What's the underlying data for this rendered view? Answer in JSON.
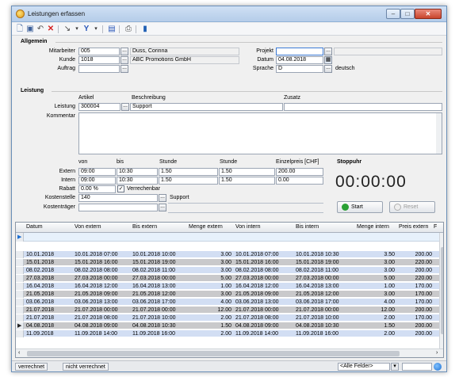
{
  "window": {
    "title": "Leistungen erfassen"
  },
  "toolbar": {
    "icons": [
      "new-doc-icon",
      "save-icon",
      "undo-icon",
      "delete-icon",
      "pointer-icon",
      "filter-icon",
      "report-icon",
      "print-icon",
      "info-icon"
    ]
  },
  "allgemein": {
    "heading": "Allgemein",
    "mitarbeiter_label": "Mitarbeiter",
    "mitarbeiter_value": "005",
    "mitarbeiter_name": "Duss, Corinna",
    "kunde_label": "Kunde",
    "kunde_value": "1018",
    "kunde_name": "ABC Promotions GmbH",
    "auftrag_label": "Auftrag",
    "auftrag_value": "",
    "projekt_label": "Projekt",
    "projekt_value": "",
    "datum_label": "Datum",
    "datum_value": "04.08.2018",
    "sprache_label": "Sprache",
    "sprache_value": "D",
    "sprache_name": "deutsch"
  },
  "leistung": {
    "heading": "Leistung",
    "col_artikel": "Artikel",
    "col_beschreibung": "Beschreibung",
    "col_zusatz": "Zusatz",
    "leistung_label": "Leistung",
    "artikel_value": "300004",
    "beschreibung_value": "Support",
    "kommentar_label": "Kommentar",
    "col_von": "von",
    "col_bis": "bis",
    "col_stunde1": "Stunde",
    "col_stunde2": "Stunde",
    "col_einzelpreis": "Einzelpreis [CHF]",
    "extern_label": "Extern",
    "extern_von": "09:00",
    "extern_bis": "10:30",
    "extern_stunde1": "1.50",
    "extern_stunde2": "1.50",
    "extern_preis": "200.00",
    "intern_label": "Intern",
    "intern_von": "09:00",
    "intern_bis": "10:30",
    "intern_stunde1": "1.50",
    "intern_stunde2": "1.50",
    "intern_preis": "0.00",
    "rabatt_label": "Rabatt",
    "rabatt_value": "0.00 %",
    "verrechenbar_label": "Verrechenbar",
    "verrechenbar_checked": "✓",
    "kostenstelle_label": "Kostenstelle",
    "kostenstelle_value": "140",
    "kostenstelle_name": "Support",
    "kostentraeger_label": "Kostenträger",
    "kostentraeger_value": ""
  },
  "stoppuhr": {
    "heading": "Stoppuhr",
    "time": "00:00:00",
    "start_label": "Start",
    "reset_label": "Reset"
  },
  "grid": {
    "headers": [
      "Datum",
      "Von extern",
      "Bis extern",
      "Menge extern",
      "Von intern",
      "Bis intern",
      "Menge intern",
      "Preis extern",
      "F"
    ],
    "rows": [
      [
        "10.01.2018",
        "10.01.2018 07:00",
        "10.01.2018 10:00",
        "3.00",
        "10.01.2018 07:00",
        "10.01.2018 10:30",
        "3.50",
        "200.00"
      ],
      [
        "15.01.2018",
        "15.01.2018 16:00",
        "15.01.2018 19:00",
        "3.00",
        "15.01.2018 16:00",
        "15.01.2018 19:00",
        "3.00",
        "220.00"
      ],
      [
        "08.02.2018",
        "08.02.2018 08:00",
        "08.02.2018 11:00",
        "3.00",
        "08.02.2018 08:00",
        "08.02.2018 11:00",
        "3.00",
        "200.00"
      ],
      [
        "27.03.2018",
        "27.03.2018 00:00",
        "27.03.2018 00:00",
        "5.00",
        "27.03.2018 00:00",
        "27.03.2018 00:00",
        "5.00",
        "220.00"
      ],
      [
        "16.04.2018",
        "16.04.2018 12:00",
        "16.04.2018 13:00",
        "1.00",
        "16.04.2018 12:00",
        "16.04.2018 13:00",
        "1.00",
        "170.00"
      ],
      [
        "21.05.2018",
        "21.05.2018 09:00",
        "21.05.2018 12:00",
        "3.00",
        "21.05.2018 09:00",
        "21.05.2018 12:00",
        "3.00",
        "170.00"
      ],
      [
        "03.06.2018",
        "03.06.2018 13:00",
        "03.06.2018 17:00",
        "4.00",
        "03.06.2018 13:00",
        "03.06.2018 17:00",
        "4.00",
        "170.00"
      ],
      [
        "21.07.2018",
        "21.07.2018 00:00",
        "21.07.2018 00:00",
        "12.00",
        "21.07.2018 00:00",
        "21.07.2018 00:00",
        "12.00",
        "200.00"
      ],
      [
        "21.07.2018",
        "21.07.2018 08:00",
        "21.07.2018 10:00",
        "2.00",
        "21.07.2018 08:00",
        "21.07.2018 10:00",
        "2.00",
        "170.00"
      ],
      [
        "04.08.2018",
        "04.08.2018 09:00",
        "04.08.2018 10:30",
        "1.50",
        "04.08.2018 09:00",
        "04.08.2018 10:30",
        "1.50",
        "200.00"
      ],
      [
        "11.09.2018",
        "11.09.2018 14:00",
        "11.09.2018 16:00",
        "2.00",
        "11.09.2018 14:00",
        "11.09.2018 16:00",
        "2.00",
        "200.00"
      ]
    ]
  },
  "statusbar": {
    "tab1": "verrechnet",
    "tab2": "nicht verrechnet",
    "filter": "<Alle Felder>"
  },
  "colors": {
    "row_blue": "#d2def3",
    "row_grey": "#c9c9cb",
    "title_gradient": "#b5cde9",
    "start_green": "#2aa134"
  }
}
